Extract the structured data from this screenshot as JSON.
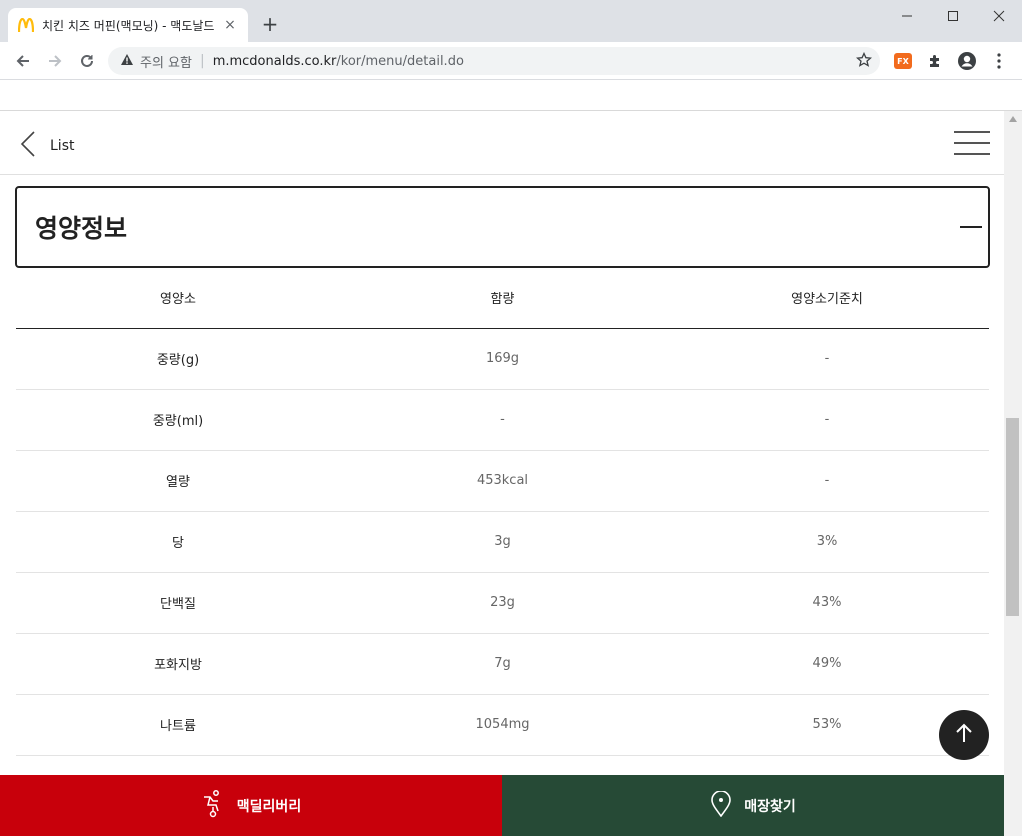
{
  "browser": {
    "tab_title": "치킨 치즈 머핀(맥모닝) - 맥도날드",
    "tab_close": "×",
    "new_tab": "+",
    "security_warning": "주의 요함",
    "url_host": "m.mcdonalds.co.kr",
    "url_path": "/kor/menu/detail.do",
    "ext_badge": "FX"
  },
  "header": {
    "back_label": "List"
  },
  "section": {
    "title": "영양정보"
  },
  "table": {
    "headers": [
      "영양소",
      "함량",
      "영양소기준치"
    ],
    "rows": [
      {
        "name": "중량(g)",
        "amount": "169g",
        "ratio": "-"
      },
      {
        "name": "중량(ml)",
        "amount": "-",
        "ratio": "-"
      },
      {
        "name": "열량",
        "amount": "453kcal",
        "ratio": "-"
      },
      {
        "name": "당",
        "amount": "3g",
        "ratio": "3%"
      },
      {
        "name": "단백질",
        "amount": "23g",
        "ratio": "43%"
      },
      {
        "name": "포화지방",
        "amount": "7g",
        "ratio": "49%"
      },
      {
        "name": "나트륨",
        "amount": "1054mg",
        "ratio": "53%"
      }
    ]
  },
  "bottom_bar": {
    "delivery_label": "맥딜리버리",
    "store_label": "매장찾기"
  },
  "colors": {
    "delivery_red": "#c8000b",
    "store_green": "#264a36",
    "brand_yellow": "#ffbc0d"
  }
}
